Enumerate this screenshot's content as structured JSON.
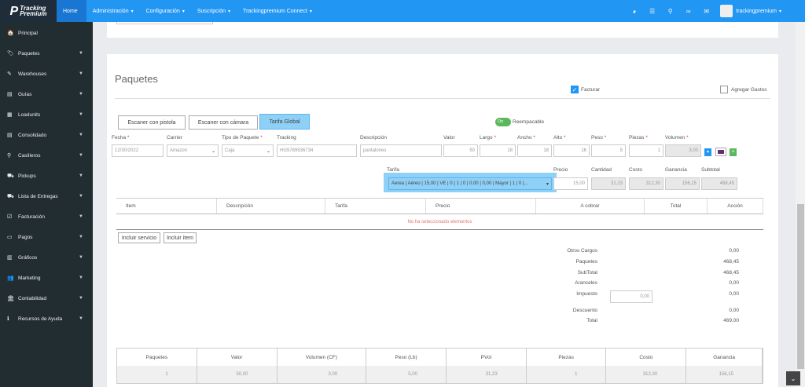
{
  "brand": {
    "line1": "Tracking",
    "line2": "Premium"
  },
  "topnav": [
    {
      "label": "Home",
      "active": true,
      "caret": ""
    },
    {
      "label": "Administración",
      "active": false,
      "caret": "▾"
    },
    {
      "label": "Configuración",
      "active": false,
      "caret": "▾"
    },
    {
      "label": "Suscripción",
      "active": false,
      "caret": "▾"
    },
    {
      "label": "Trackingpremium Connect",
      "active": false,
      "caret": "▾"
    }
  ],
  "user": {
    "name": "trackingpremium"
  },
  "sidebar": [
    {
      "label": "Principal",
      "icon": "🏠",
      "arrow": false
    },
    {
      "label": "Paquetes",
      "icon": "🏷",
      "arrow": true
    },
    {
      "label": "Warehouses",
      "icon": "✎",
      "arrow": true
    },
    {
      "label": "Guías",
      "icon": "▤",
      "arrow": true
    },
    {
      "label": "Loadunits",
      "icon": "▦",
      "arrow": true
    },
    {
      "label": "Consolidado",
      "icon": "▤",
      "arrow": true
    },
    {
      "label": "Casilleros",
      "icon": "⚲",
      "arrow": true
    },
    {
      "label": "Pickups",
      "icon": "⛟",
      "arrow": true
    },
    {
      "label": "Lista de Entregas",
      "icon": "⛟",
      "arrow": true
    },
    {
      "label": "Facturación",
      "icon": "☑",
      "arrow": true
    },
    {
      "label": "Pagos",
      "icon": "▭",
      "arrow": true
    },
    {
      "label": "Gráficos",
      "icon": "▥",
      "arrow": true
    },
    {
      "label": "Marketing",
      "icon": "👥",
      "arrow": true
    },
    {
      "label": "Contabilidad",
      "icon": "🏛",
      "arrow": true
    },
    {
      "label": "Recursos de Ayuda",
      "icon": "ℹ",
      "arrow": true
    }
  ],
  "page": {
    "title": "Paquetes",
    "facturar": "Facturar",
    "agregar_gastos": "Agregar Gastos",
    "btn_pistola": "Escaner con pistola",
    "btn_camara": "Escaner con cámara",
    "btn_tarifa_global": "Tarifa Global",
    "toggle_on": "On",
    "reempacable": "Reempacable"
  },
  "fields": {
    "fecha": {
      "label": "Fecha",
      "value": "12/30/2022"
    },
    "carrier": {
      "label": "Carrier",
      "value": "Amazon"
    },
    "tipo": {
      "label": "Tipo de Paquete",
      "value": "Caja"
    },
    "tracking": {
      "label": "Tracking",
      "value": "HG5789536734"
    },
    "descripcion": {
      "label": "Descripción",
      "value": "pantalones"
    },
    "valor": {
      "label": "Valor",
      "value": "50"
    },
    "largo": {
      "label": "Largo",
      "value": "18"
    },
    "ancho": {
      "label": "Ancho",
      "value": "18"
    },
    "alto": {
      "label": "Alto",
      "value": "16"
    },
    "peso": {
      "label": "Peso",
      "value": "5"
    },
    "piezas": {
      "label": "Piezas",
      "value": "1"
    },
    "volumen": {
      "label": "Volumen",
      "value": "3,00"
    }
  },
  "tarifa": {
    "label": "Tarifa",
    "value": "Aerea | Aéreo | 15,00 | VE | 0 | 1 | 0 | 0,00 | 0,00 | Mayor | 1 | 0 |...",
    "precio_label": "Precio",
    "precio": "15,00",
    "cantidad_label": "Cantidad",
    "cantidad": "31,23",
    "costo_label": "Costo",
    "costo": "312,30",
    "ganancia_label": "Ganancia",
    "ganancia": "156,15",
    "subtotal_label": "Subtotal",
    "subtotal": "468,45"
  },
  "items_table": {
    "headers": [
      "Item",
      "Descripción",
      "Tarifa",
      "Precio",
      "A cobrar",
      "Total",
      "Acción"
    ],
    "empty": "No ha seleccionado elementos"
  },
  "buttons": {
    "incluir_servicio": "Incluir servicio",
    "incluir_item": "Incluir item"
  },
  "totals": {
    "otros_cargos_label": "Otros Cargos",
    "otros_cargos": "0,00",
    "paquetes_label": "Paquetes",
    "paquetes": "468,45",
    "subtotal_label": "SubTotal",
    "subtotal": "468,45",
    "aranceles_label": "Aranceles",
    "aranceles": "0,00",
    "impuesto_label": "Impuesto",
    "impuesto_input": "0,00",
    "impuesto": "0,00",
    "descuento_label": "Descuento",
    "descuento": "0,00",
    "total_label": "Total",
    "total": "469,00"
  },
  "summary": {
    "headers": [
      "Paquetes",
      "Valor",
      "Volumen (CF)",
      "Peso (Lb)",
      "PVol",
      "Piezas",
      "Costo",
      "Ganancia"
    ],
    "values": [
      "1",
      "50,00",
      "3,00",
      "5,00",
      "31,23",
      "1",
      "312,30",
      "156,15"
    ]
  }
}
